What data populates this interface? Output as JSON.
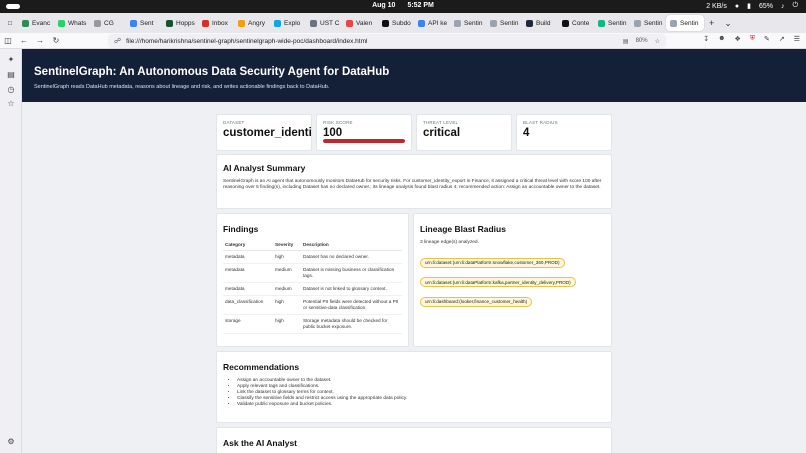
{
  "os": {
    "date": "Aug 10",
    "time": "5:52 PM",
    "network": "2 KB/s",
    "battery": "65%"
  },
  "tabs": [
    {
      "label": "Evanc",
      "color": "#2e8b57"
    },
    {
      "label": "Whats",
      "color": "#25d366"
    },
    {
      "label": "CG",
      "color": "#999999"
    },
    {
      "label": "Sent",
      "color": "#3b82f6"
    },
    {
      "label": "Hopps",
      "color": "#14532d"
    },
    {
      "label": "Inbox",
      "color": "#d93025"
    },
    {
      "label": "Angry",
      "color": "#f59e0b"
    },
    {
      "label": "Explo",
      "color": "#0ea5e9"
    },
    {
      "label": "UST C",
      "color": "#6b7280"
    },
    {
      "label": "Valen",
      "color": "#ef4444"
    },
    {
      "label": "Subdo",
      "color": "#111111"
    },
    {
      "label": "API ke",
      "color": "#3b82f6"
    },
    {
      "label": "Sentin",
      "color": "#9ca3af"
    },
    {
      "label": "Sentin",
      "color": "#9ca3af"
    },
    {
      "label": "Build",
      "color": "#1f2937"
    },
    {
      "label": "Conte",
      "color": "#111111"
    },
    {
      "label": "Sentin",
      "color": "#10b981"
    },
    {
      "label": "Sentin",
      "color": "#9ca3af"
    },
    {
      "label": "Sentin",
      "color": "#9ca3af",
      "active": true
    }
  ],
  "browser": {
    "url": "file:///home/harikrishna/sentinel-graph/sentinelgraph-wide-poc/dashboard/index.html",
    "zoom": "80%"
  },
  "page": {
    "title": "SentinelGraph: An Autonomous Data Security Agent for DataHub",
    "subtitle": "SentinelGraph reads DataHub metadata, reasons about lineage and risk, and writes actionable findings back to DataHub."
  },
  "metrics": {
    "dataset_label": "DATASET",
    "dataset_value": "customer_identity_export",
    "risk_label": "RISK SCORE",
    "risk_value": "100",
    "risk_fraction": 1.0,
    "threat_label": "THREAT LEVEL",
    "threat_value": "critical",
    "blast_label": "BLAST RADIUS",
    "blast_value": "4"
  },
  "summary": {
    "heading": "AI Analyst Summary",
    "text": "SentinelGraph is an AI agent that autonomously monitors DataHub for security risks. For customer_identity_export in Finance, it assigned a critical threat level with score 100 after reasoning over 5 finding(s), including Dataset has no declared owner.; its lineage analysis found blast radius 4; recommended action: Assign an accountable owner to the dataset."
  },
  "findings": {
    "heading": "Findings",
    "columns": [
      "Category",
      "Severity",
      "Description"
    ],
    "rows": [
      [
        "metadata",
        "high",
        "Dataset has no declared owner."
      ],
      [
        "metadata",
        "medium",
        "Dataset is missing business or classification tags."
      ],
      [
        "metadata",
        "medium",
        "Dataset is not linked to glossary context."
      ],
      [
        "data_classification",
        "high",
        "Potential PII fields were detected without a PII or sensitive-data classification."
      ],
      [
        "storage",
        "high",
        "Storage metadata should be checked for public bucket exposure."
      ]
    ]
  },
  "lineage": {
    "heading": "Lineage Blast Radius",
    "count_text": "3 lineage edge(s) analyzed.",
    "edges": [
      "urn:li:dataset:(urn:li:dataPlatform:snowflake,customer_360,PROD)",
      "urn:li:dataset:(urn:li:dataPlatform:kafka,partner_identity_delivery,PROD)",
      "urn:li:dashboard:(looker,finance_customer_health)"
    ]
  },
  "recommendations": {
    "heading": "Recommendations",
    "items": [
      "Assign an accountable owner to the dataset.",
      "Apply relevant tags and classifications.",
      "Link the dataset to glossary terms for context.",
      "Classify the sensitive fields and restrict access using the appropriate data policy.",
      "Validate public exposure and bucket policies."
    ]
  },
  "ask": {
    "heading": "Ask the AI Analyst"
  }
}
